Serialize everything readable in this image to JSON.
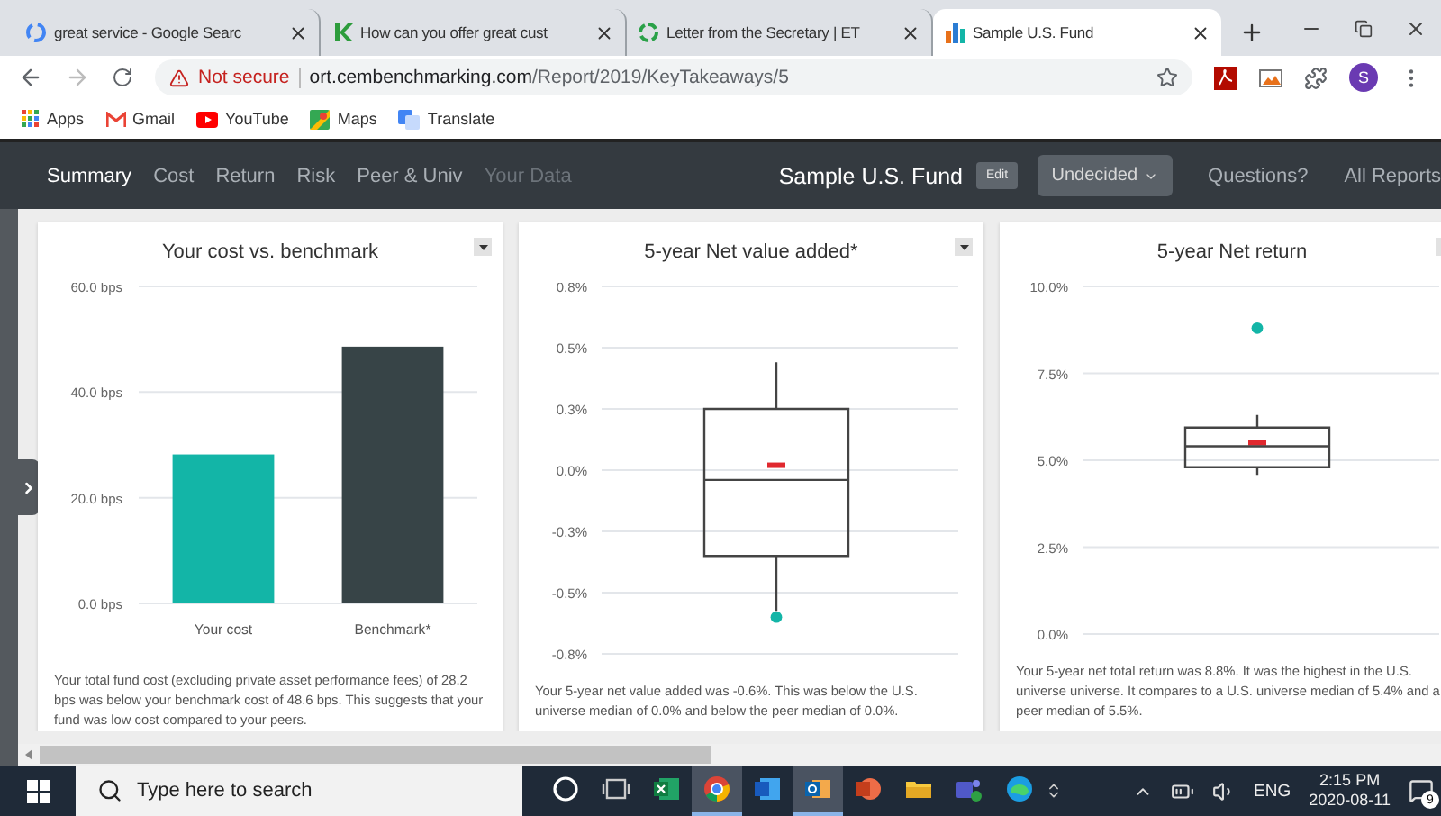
{
  "browser": {
    "tabs": [
      {
        "title": "great service - Google Searc",
        "kind": "google",
        "selected": false
      },
      {
        "title": "How can you offer great cust",
        "kind": "k",
        "selected": false
      },
      {
        "title": "Letter from the Secretary | ET",
        "kind": "ring",
        "selected": false
      },
      {
        "title": "Sample U.S. Fund",
        "kind": "bars",
        "selected": true
      }
    ],
    "security": "Not secure",
    "url_host": "ort.cembenchmarking.com",
    "url_path": "/Report/2019/KeyTakeaways/5",
    "profile_initial": "S",
    "bookmarks": [
      {
        "label": "Apps",
        "kind": "apps"
      },
      {
        "label": "Gmail",
        "kind": "gmail"
      },
      {
        "label": "YouTube",
        "kind": "youtube"
      },
      {
        "label": "Maps",
        "kind": "maps"
      },
      {
        "label": "Translate",
        "kind": "translate"
      }
    ]
  },
  "nav": {
    "items": [
      {
        "label": "Summary",
        "selected": true,
        "disabled": false
      },
      {
        "label": "Cost",
        "selected": false,
        "disabled": false
      },
      {
        "label": "Return",
        "selected": false,
        "disabled": false
      },
      {
        "label": "Risk",
        "selected": false,
        "disabled": false
      },
      {
        "label": "Peer & Univ",
        "selected": false,
        "disabled": false
      },
      {
        "label": "Your Data",
        "selected": false,
        "disabled": true
      }
    ],
    "fund_title": "Sample U.S. Fund",
    "edit_button": "Edit",
    "status_dropdown": "Undecided",
    "links": [
      "Questions?",
      "All Reports"
    ]
  },
  "cards": [
    {
      "title": "Your cost vs. benchmark",
      "chart_data": {
        "type": "bar",
        "categories": [
          "Your cost",
          "Benchmark*"
        ],
        "grid": true,
        "ylim": [
          0,
          60
        ],
        "yticks": [
          {
            "value": 0,
            "label": "0.0 bps"
          },
          {
            "value": 20,
            "label": "20.0 bps"
          },
          {
            "value": 40,
            "label": "40.0 bps"
          },
          {
            "value": 60,
            "label": "60.0 bps"
          }
        ],
        "series": [
          {
            "color": "#13b5a7",
            "values": [
              28.2,
              null
            ]
          },
          {
            "color": "#374447",
            "values": [
              null,
              48.6
            ]
          }
        ]
      },
      "description": "Your total fund cost (excluding private asset performance fees) of 28.2 bps was below your benchmark cost of 48.6 bps. This suggests that your fund was low cost compared to your peers."
    },
    {
      "title": "5-year Net value added*",
      "chart_data": {
        "type": "scatter",
        "ylim": [
          -0.75,
          0.75
        ],
        "yticks": [
          {
            "value": 0.75,
            "label": "0.8%"
          },
          {
            "value": 0.5,
            "label": "0.5%"
          },
          {
            "value": 0.25,
            "label": "0.3%"
          },
          {
            "value": 0,
            "label": "0.0%"
          },
          {
            "value": -0.25,
            "label": "-0.3%"
          },
          {
            "value": -0.5,
            "label": "-0.5%"
          },
          {
            "value": -0.75,
            "label": "-0.8%"
          }
        ],
        "series": [
          {
            "color": "#13b5a7",
            "values": [
              -0.6
            ]
          },
          {
            "color": "#e0282e",
            "values": [
              0.02
            ]
          }
        ],
        "grid": true
      },
      "description": "Your 5-year net value added was -0.6%. This was below the U.S. universe median of 0.0% and below the peer median of 0.0%."
    },
    {
      "title": "5-year Net return",
      "chart_data": {
        "type": "scatter",
        "ylim": [
          0,
          10
        ],
        "yticks": [
          {
            "value": 0,
            "label": "0.0%"
          },
          {
            "value": 2.5,
            "label": "2.5%"
          },
          {
            "value": 5,
            "label": "5.0%"
          },
          {
            "value": 7.5,
            "label": "7.5%"
          },
          {
            "value": 10,
            "label": "10.0%"
          }
        ],
        "series": [
          {
            "color": "#13b5a7",
            "values": [
              8.8
            ]
          },
          {
            "color": "#e0282e",
            "values": [
              5.5
            ]
          }
        ],
        "grid": true
      },
      "description": "Your 5-year net total return was 8.8%. It was the highest in the U.S. universe universe. It compares to a U.S. universe median of 5.4% and a peer median of 5.5%."
    }
  ],
  "taskbar": {
    "search_placeholder": "Type here to search",
    "apps": [
      {
        "kind": "cortana",
        "active": false
      },
      {
        "kind": "taskview",
        "active": false
      },
      {
        "kind": "excel",
        "active": false
      },
      {
        "kind": "chrome",
        "active": true
      },
      {
        "kind": "word",
        "active": false
      },
      {
        "kind": "outlook",
        "active": true
      },
      {
        "kind": "powerpoint",
        "active": false
      },
      {
        "kind": "explorer",
        "active": false
      },
      {
        "kind": "teams",
        "active": false
      },
      {
        "kind": "edge",
        "active": false
      }
    ],
    "language": "ENG",
    "time": "2:15 PM",
    "date": "2020-08-11",
    "notifications": "9"
  }
}
